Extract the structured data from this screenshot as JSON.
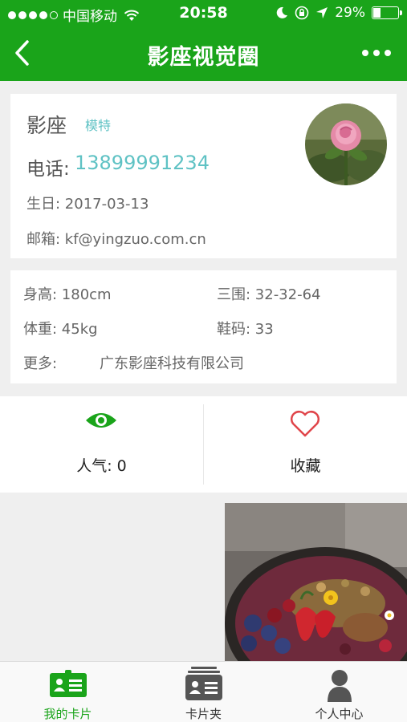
{
  "status_bar": {
    "carrier": "中国移动",
    "time": "20:58",
    "battery": "29%",
    "battery_level": 0.29
  },
  "nav": {
    "title": "影座视觉圈",
    "back_icon": "chevron-left-icon",
    "more_icon": "more-dots-icon"
  },
  "profile": {
    "name": "影座",
    "role": "模特",
    "phone_label": "电话:",
    "phone": "13899991234",
    "birthday": "生日: 2017-03-13",
    "email": "邮箱: kf@yingzuo.com.cn"
  },
  "attributes": {
    "height": "身高: 180cm",
    "measurements": "三围: 32-32-64",
    "weight": "体重: 45kg",
    "shoe_size": "鞋码: 33",
    "more_label": "更多:",
    "more_value": "广东影座科技有限公司"
  },
  "stats": {
    "popularity": "人气:  0",
    "collect": "收藏"
  },
  "tabs": [
    {
      "label": "我的卡片",
      "icon": "id-card-icon",
      "active": true
    },
    {
      "label": "卡片夹",
      "icon": "card-folder-icon",
      "active": false
    },
    {
      "label": "个人中心",
      "icon": "user-icon",
      "active": false
    }
  ],
  "colors": {
    "brand_green": "#1aa41a",
    "teal_text": "#5fc2c4",
    "heart_red": "#e0454a"
  }
}
